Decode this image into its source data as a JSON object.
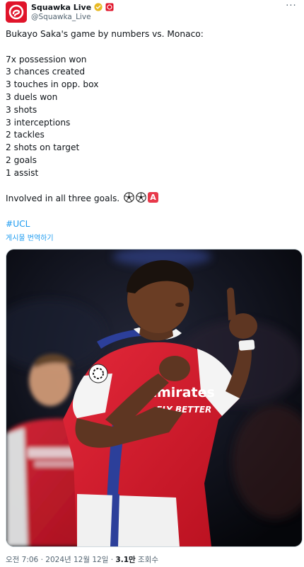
{
  "account": {
    "display_name": "Squawka Live",
    "handle": "@Squawka_Live",
    "verified_icon": "verified-badge-icon",
    "affiliate_icon": "affiliate-badge-icon",
    "more_label": "···"
  },
  "tweet": {
    "intro": "Bukayo Saka's game by numbers vs. Monaco:",
    "stats": [
      "7x possession won",
      "3 chances created",
      "3 touches in opp. box",
      "3 duels won",
      "3 shots",
      "3 interceptions",
      "2 tackles",
      "2 shots on target",
      "2 goals",
      "1 assist"
    ],
    "summary": "Involved in all three goals.",
    "emoji_letter": "A",
    "hashtag": "#UCL",
    "translate_label": "게시물 번역하기"
  },
  "media": {
    "jersey_text_1": "Emirates",
    "jersey_text_2": "FLY BETTER"
  },
  "footer": {
    "time": "오전 7:06",
    "separator": "·",
    "date": "2024년 12월 12일",
    "views_count": "3.1만",
    "views_label": "조회수"
  },
  "colors": {
    "brand_red": "#e0142a",
    "link_blue": "#1d9bf0",
    "text_secondary": "#536471"
  }
}
